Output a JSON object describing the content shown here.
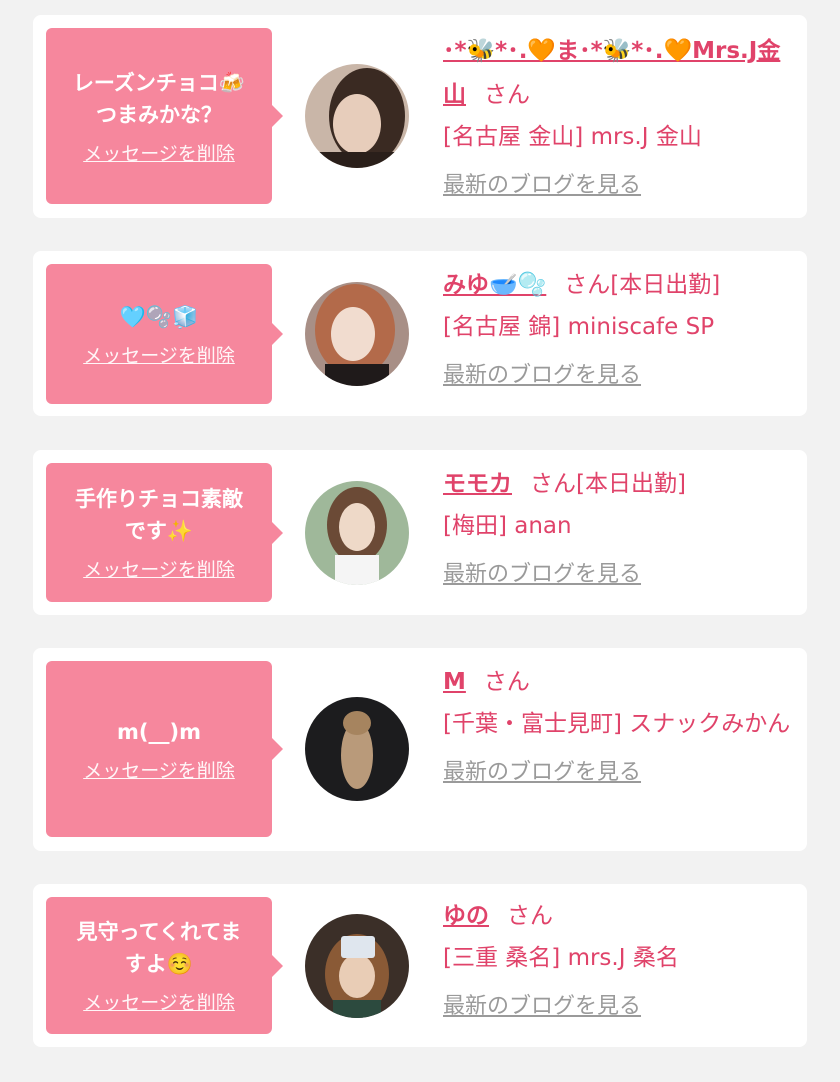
{
  "delete_label": "メッセージを削除",
  "blog_label": "最新のブログを見る",
  "san_label": "さん",
  "colors": {
    "accent": "#e0436a",
    "bubble": "#f6879d",
    "link_gray": "#9a9a9a",
    "background": "#f2f2f2"
  },
  "entries": [
    {
      "message": "レーズンチョコ🍻\nつまみかな？",
      "name": "･*🐝*･.🧡ま･*🐝*･.🧡Mrs.J金山",
      "status": "",
      "shop": "[名古屋 金山] mrs.J 金山"
    },
    {
      "message": "🩵🫧🧊",
      "name": "みゆ🥣🫧",
      "status": "[本日出勤]",
      "shop": "[名古屋 錦] miniscafe SP"
    },
    {
      "message": "手作りチョコ素敵\nです✨",
      "name": "モモカ",
      "status": "[本日出勤]",
      "shop": "[梅田] anan"
    },
    {
      "message": "m(__)m",
      "name": "M",
      "status": "",
      "shop": "[千葉・富士見町] スナックみかん"
    },
    {
      "message": "見守ってくれてま\nすよ☺️",
      "name": "ゆの",
      "status": "",
      "shop": "[三重 桑名] mrs.J 桑名"
    }
  ]
}
